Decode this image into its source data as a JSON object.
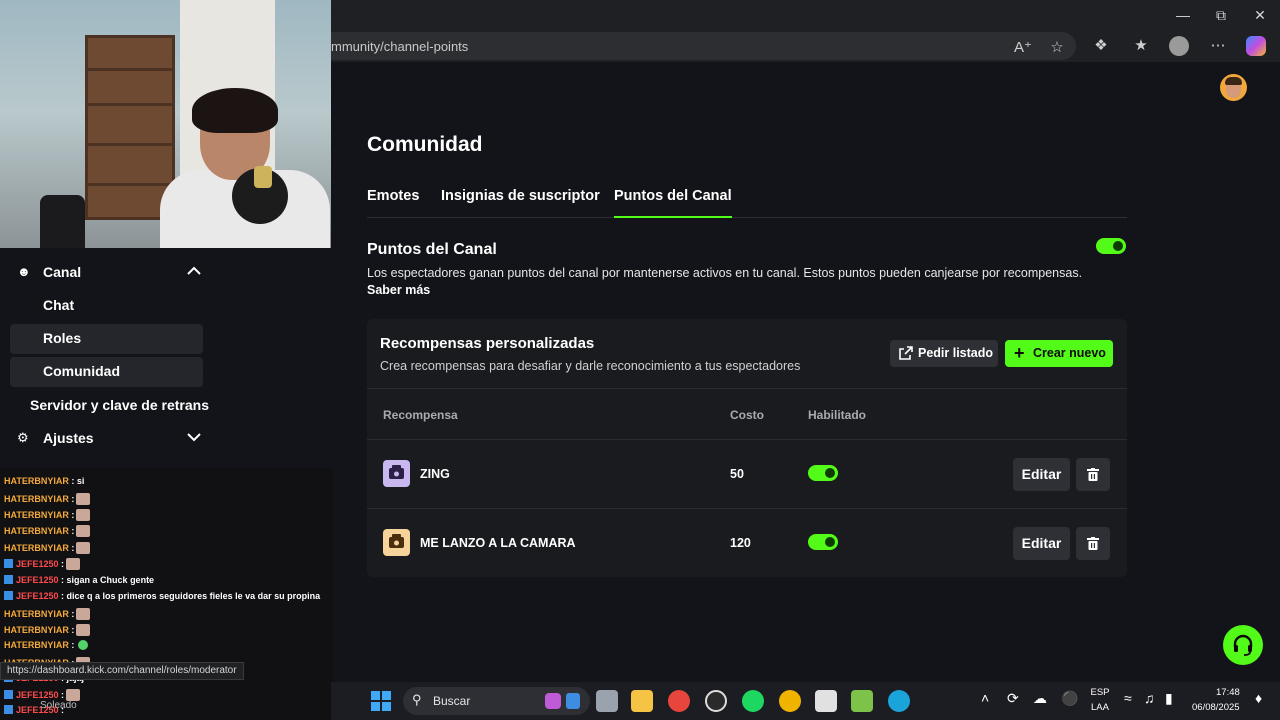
{
  "browser": {
    "url": "mmunity/channel-points"
  },
  "sidebar": {
    "items": [
      {
        "label": "Canal"
      },
      {
        "label": "Chat"
      },
      {
        "label": "Roles"
      },
      {
        "label": "Comunidad"
      },
      {
        "label": "Servidor y clave de retrans"
      },
      {
        "label": "Ajustes"
      }
    ]
  },
  "page": {
    "title": "Comunidad",
    "tabs": [
      "Emotes",
      "Insignias de suscriptor",
      "Puntos del Canal"
    ],
    "active_tab": "Puntos del Canal"
  },
  "channel_points": {
    "title": "Puntos del Canal",
    "description": "Los espectadores ganan puntos del canal por mantenerse activos en tu canal. Estos puntos pueden canjearse por recompensas.",
    "learn_more": "Saber más",
    "enabled": true
  },
  "rewards": {
    "title": "Recompensas personalizadas",
    "description": "Crea recompensas para desafiar y darle reconocimiento a tus espectadores",
    "request_list_label": "Pedir listado",
    "create_label": "Crear nuevo",
    "columns": [
      "Recompensa",
      "Costo",
      "Habilitado"
    ],
    "rows": [
      {
        "name": "ZING",
        "cost": "50",
        "enabled": true,
        "icon_color": "#c9b7f0",
        "edit_label": "Editar"
      },
      {
        "name": "ME LANZO A LA CAMARA",
        "cost": "120",
        "enabled": true,
        "icon_color": "#f6d39a",
        "edit_label": "Editar"
      }
    ]
  },
  "chat": {
    "lines": [
      {
        "user": "HATERBNYIAR",
        "text": ": si",
        "kind": "h"
      },
      {
        "user": "HATERBNYIAR",
        "text": ":",
        "kind": "h"
      },
      {
        "user": "HATERBNYIAR",
        "text": ":",
        "kind": "h"
      },
      {
        "user": "HATERBNYIAR",
        "text": ":",
        "kind": "h"
      },
      {
        "user": "HATERBNYIAR",
        "text": ":",
        "kind": "h"
      },
      {
        "user": "JEFE1250",
        "text": ":",
        "kind": "j"
      },
      {
        "user": "JEFE1250",
        "text": ": sigan a Chuck gente",
        "kind": "j"
      },
      {
        "user": "JEFE1250",
        "text": ": dice q a los primeros seguidores fieles le va dar su propina",
        "kind": "j"
      },
      {
        "user": "HATERBNYIAR",
        "text": ":",
        "kind": "h"
      },
      {
        "user": "HATERBNYIAR",
        "text": ":",
        "kind": "h"
      },
      {
        "user": "HATERBNYIAR",
        "text": ":",
        "kind": "h"
      },
      {
        "user": "HATERBNYIAR",
        "text": ":",
        "kind": "h"
      },
      {
        "user": "JEFE1250",
        "text": ": jajaj",
        "kind": "j"
      },
      {
        "user": "JEFE1250",
        "text": ":",
        "kind": "j"
      },
      {
        "user": "JEFE1250",
        "text": ":",
        "kind": "j"
      }
    ]
  },
  "status_bar": {
    "url": "https://dashboard.kick.com/channel/roles/moderator"
  },
  "weather": {
    "label": "Soleado"
  },
  "taskbar": {
    "search_label": "Buscar",
    "lang_top": "ESP",
    "lang_bottom": "LAA",
    "time": "17:48",
    "date": "06/08/2025"
  },
  "colors": {
    "accent": "#53fc18",
    "background": "#131419",
    "card": "#191b1f"
  }
}
